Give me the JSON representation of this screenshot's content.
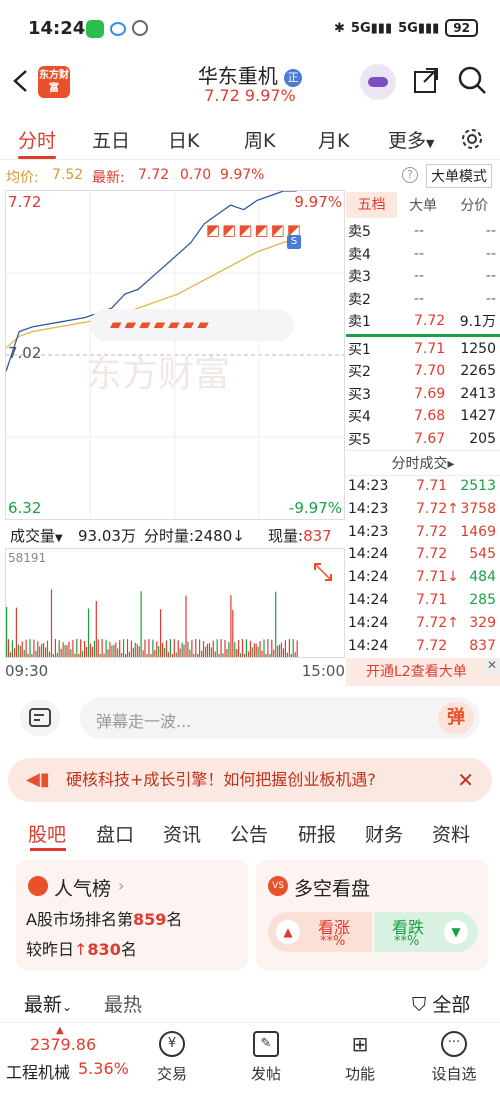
{
  "status": {
    "time": "14:24",
    "battery": "92",
    "net1": "5G",
    "net2": "5G"
  },
  "header": {
    "back_icon": "chevron-left-icon",
    "logo_text": "东方财富",
    "stock_name": "华东重机",
    "badge": "正",
    "price_line": "7.72  9.97%"
  },
  "tabs": [
    "分时",
    "五日",
    "日K",
    "周K",
    "月K",
    "更多"
  ],
  "infobar": {
    "avg_label": "均价:",
    "avg": "7.52",
    "latest_label": "最新:",
    "latest": "7.72",
    "change": "0.70",
    "pct": "9.97%",
    "mode": "大单模式"
  },
  "chart": {
    "top_price": "7.72",
    "top_pct": "9.97%",
    "mid_price": "7.02",
    "bottom_price": "6.32",
    "bottom_pct": "-9.97%",
    "watermark": "东方财富",
    "badge": "S",
    "open": "09:30",
    "close": "15:00"
  },
  "chart_data": {
    "type": "line",
    "x_range": [
      "09:30",
      "15:00"
    ],
    "ylim": [
      6.32,
      7.72
    ],
    "baseline": 7.02,
    "price": [
      6.95,
      7.12,
      7.14,
      7.15,
      7.16,
      7.17,
      7.18,
      7.2,
      7.22,
      7.28,
      7.3,
      7.35,
      7.4,
      7.45,
      7.5,
      7.58,
      7.62,
      7.66,
      7.64,
      7.68,
      7.7,
      7.72,
      7.72
    ],
    "avg": [
      7.05,
      7.1,
      7.12,
      7.13,
      7.14,
      7.15,
      7.16,
      7.17,
      7.18,
      7.2,
      7.22,
      7.24,
      7.26,
      7.28,
      7.31,
      7.34,
      7.37,
      7.4,
      7.43,
      7.46,
      7.48,
      7.5,
      7.52
    ]
  },
  "volume": {
    "label": "成交量",
    "total": "93.03万",
    "period_label": "分时量:",
    "period": "2480",
    "now_label": "现量:",
    "now": "837",
    "max": "58191"
  },
  "orderbook": {
    "tabs": [
      "五档",
      "大单",
      "分价"
    ],
    "sells": [
      {
        "label": "卖5",
        "price": "--",
        "vol": "--"
      },
      {
        "label": "卖4",
        "price": "--",
        "vol": "--"
      },
      {
        "label": "卖3",
        "price": "--",
        "vol": "--"
      },
      {
        "label": "卖2",
        "price": "--",
        "vol": "--"
      },
      {
        "label": "卖1",
        "price": "7.72",
        "vol": "9.1万"
      }
    ],
    "buys": [
      {
        "label": "买1",
        "price": "7.71",
        "vol": "1250"
      },
      {
        "label": "买2",
        "price": "7.70",
        "vol": "2265"
      },
      {
        "label": "买3",
        "price": "7.69",
        "vol": "2413"
      },
      {
        "label": "买4",
        "price": "7.68",
        "vol": "1427"
      },
      {
        "label": "买5",
        "price": "7.67",
        "vol": "205"
      }
    ]
  },
  "trades": {
    "title": "分时成交",
    "rows": [
      {
        "t": "14:23",
        "p": "7.71",
        "v": "2513",
        "c": "green",
        "a": ""
      },
      {
        "t": "14:23",
        "p": "7.72",
        "v": "3758",
        "c": "red",
        "a": "↑"
      },
      {
        "t": "14:23",
        "p": "7.72",
        "v": "1469",
        "c": "red",
        "a": ""
      },
      {
        "t": "14:24",
        "p": "7.72",
        "v": "545",
        "c": "red",
        "a": ""
      },
      {
        "t": "14:24",
        "p": "7.71",
        "v": "484",
        "c": "green",
        "a": "↓"
      },
      {
        "t": "14:24",
        "p": "7.71",
        "v": "285",
        "c": "green",
        "a": ""
      },
      {
        "t": "14:24",
        "p": "7.72",
        "v": "329",
        "c": "red",
        "a": "↑"
      },
      {
        "t": "14:24",
        "p": "7.72",
        "v": "837",
        "c": "red",
        "a": ""
      }
    ]
  },
  "promo": "开通L2查看大单",
  "comment": {
    "placeholder": "弹幕走一波...",
    "send": "弹"
  },
  "banner": "硬核科技+成长引擎！如何把握创业板机遇?",
  "secnav": [
    "股吧",
    "盘口",
    "资讯",
    "公告",
    "研报",
    "财务",
    "资料"
  ],
  "cards": {
    "pop_title": "人气榜",
    "pop_line1_a": "A股市场排名第",
    "pop_rank": "859",
    "pop_line1_b": "名",
    "pop_line2_a": "较昨日",
    "pop_delta": "830",
    "pop_line2_b": "名",
    "vs_title": "多空看盘",
    "bull": "看涨",
    "bull_pct": "**%",
    "bear": "看跌",
    "bear_pct": "**%"
  },
  "filter": {
    "latest": "最新",
    "hot": "最热",
    "all": "全部"
  },
  "bottom": {
    "index_value": "2379.86",
    "index_name": "工程机械",
    "index_pct": "5.36%",
    "items": [
      "交易",
      "发帖",
      "功能",
      "设自选"
    ]
  },
  "colors": {
    "red": "#e03b2f",
    "green": "#1aa146",
    "blue": "#2d5aa8"
  }
}
